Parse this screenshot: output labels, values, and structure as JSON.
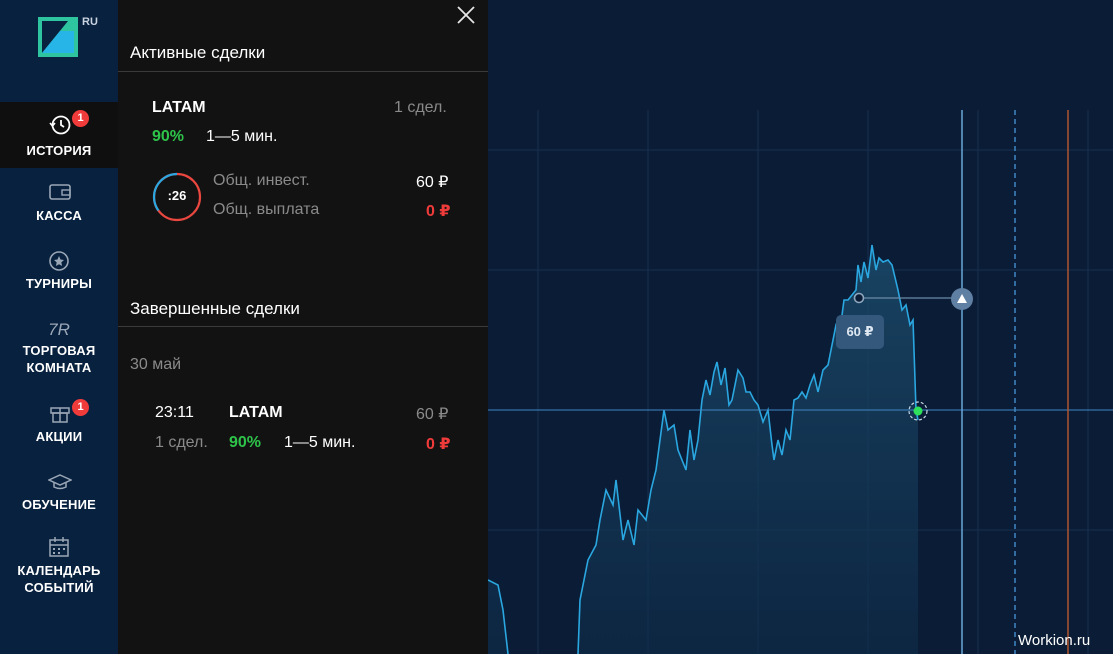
{
  "logo": {
    "region": "RU"
  },
  "sidebar": {
    "items": [
      {
        "label": "ИСТОРИЯ",
        "badge": "1",
        "icon": "history-icon"
      },
      {
        "label": "КАССА",
        "icon": "wallet-icon"
      },
      {
        "label": "ТУРНИРЫ",
        "icon": "star-icon"
      },
      {
        "label_line1": "ТОРГОВАЯ",
        "label_line2": "КОМНАТА",
        "icon_text": "7R",
        "icon": "trading-room-icon"
      },
      {
        "label": "АКЦИИ",
        "badge": "1",
        "icon": "gift-icon"
      },
      {
        "label": "ОБУЧЕНИЕ",
        "icon": "graduation-cap-icon"
      },
      {
        "label_line1": "КАЛЕНДАРЬ",
        "label_line2": "СОБЫТИЙ",
        "icon": "calendar-icon"
      }
    ]
  },
  "active": {
    "title": "Активные сделки",
    "asset": "LATAM",
    "count": "1 сдел.",
    "percent": "90%",
    "duration": "1—5 мин.",
    "timer": ":26",
    "invest_label": "Общ. инвест.",
    "invest_value": "60 ₽",
    "payout_label": "Общ. выплата",
    "payout_value": "0 ₽"
  },
  "completed": {
    "title": "Завершенные сделки",
    "date": "30 май",
    "time": "23:11",
    "asset": "LATAM",
    "amount": "60 ₽",
    "count": "1 сдел.",
    "percent": "90%",
    "duration": "1—5 мин.",
    "payout": "0 ₽"
  },
  "chart": {
    "tooltip": "60 ₽"
  },
  "watermark": "Workion.ru",
  "colors": {
    "accent_green": "#2ec44a",
    "loss_red": "#f03b3b",
    "line_blue": "#2aa7e0",
    "sidebar_bg": "#08213f",
    "panel_bg": "#121212"
  }
}
